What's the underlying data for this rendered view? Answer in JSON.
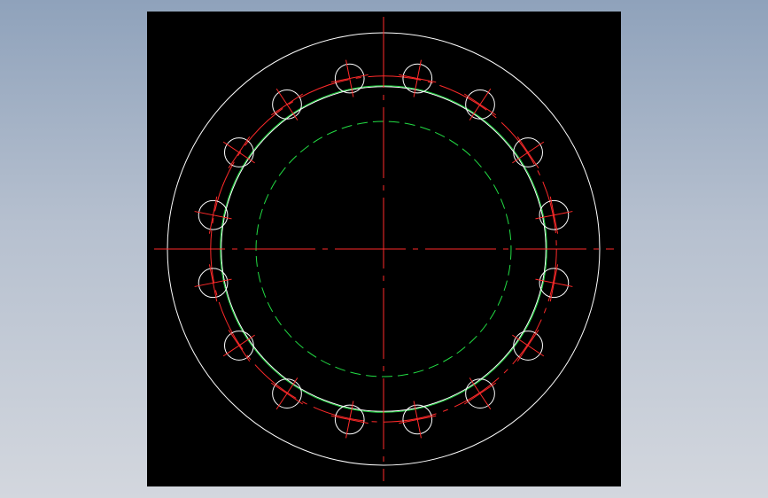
{
  "drawing": {
    "type": "flange-drawing",
    "background": "#000000",
    "page_background": "#a7b4c6",
    "colors": {
      "outline": "#ffffff",
      "centerline": "#ff2a2a",
      "hidden": "#22dd44"
    },
    "bolt_hole_count": 16,
    "bolt_hole_start_angle_deg": 11.25,
    "diameter_ratios": {
      "outer": 1.0,
      "bolt_circle": 0.8,
      "inner_outline": 0.751,
      "inner_offset": 0.747,
      "hidden_bore": 0.59,
      "bolt_hole": 0.067
    },
    "bolt_circle_style": "center-dash",
    "hidden_bore_style": "dashed"
  }
}
